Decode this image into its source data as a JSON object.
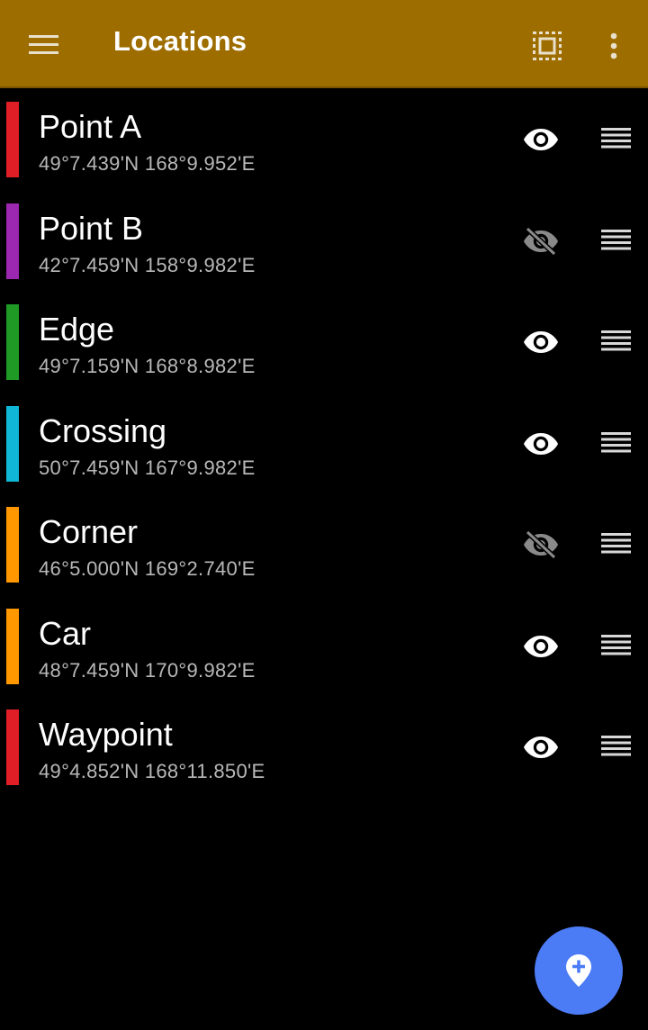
{
  "app_bar": {
    "title": "Locations",
    "background_color": "#9e6d00",
    "icons": {
      "menu": "hamburger-menu-icon",
      "select": "select-all-icon",
      "more": "more-vert-icon"
    }
  },
  "locations": [
    {
      "name": "Point A",
      "coords": "49°7.439'N 168°9.952'E",
      "color": "#e01e26",
      "visible": true
    },
    {
      "name": "Point B",
      "coords": "42°7.459'N 158°9.982'E",
      "color": "#9c27b0",
      "visible": false
    },
    {
      "name": "Edge",
      "coords": "49°7.159'N 168°8.982'E",
      "color": "#1e9a25",
      "visible": true
    },
    {
      "name": "Crossing",
      "coords": "50°7.459'N 167°9.982'E",
      "color": "#11b7d6",
      "visible": true
    },
    {
      "name": "Corner",
      "coords": "46°5.000'N 169°2.740'E",
      "color": "#ff9800",
      "visible": false
    },
    {
      "name": "Car",
      "coords": "48°7.459'N 170°9.982'E",
      "color": "#ff9800",
      "visible": true
    },
    {
      "name": "Waypoint",
      "coords": "49°4.852'N 168°11.850'E",
      "color": "#e01e26",
      "visible": true
    }
  ],
  "fab": {
    "icon": "add-location-icon",
    "color": "#4c7cf5"
  }
}
